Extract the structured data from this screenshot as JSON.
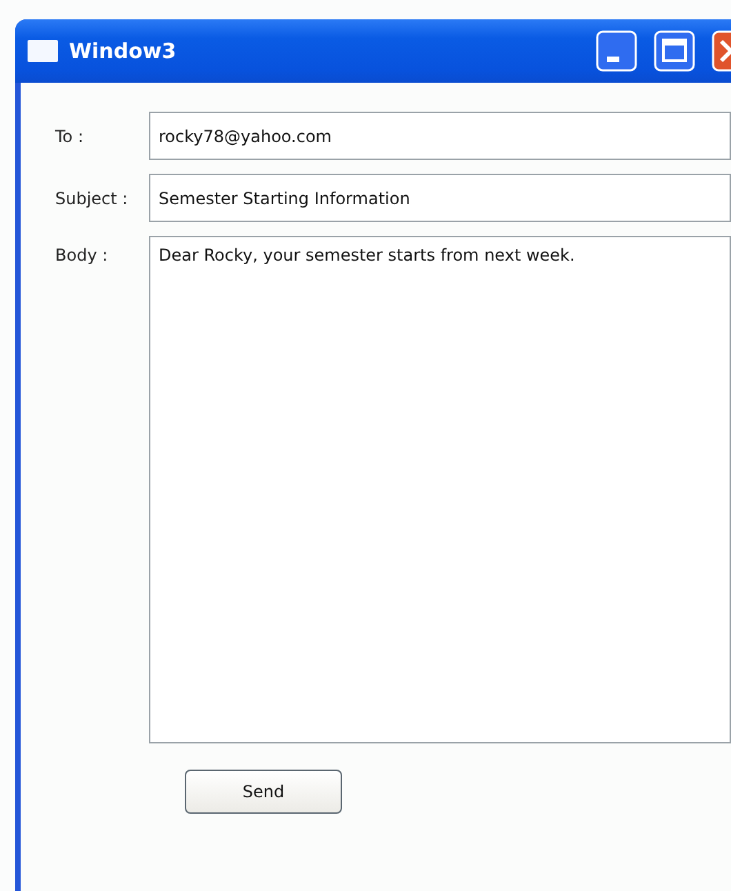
{
  "window": {
    "title": "Window3"
  },
  "fields": [
    {
      "label": "To :",
      "value": "rocky78@yahoo.com",
      "kind": "line"
    },
    {
      "label": "Subject :",
      "value": "Semester Starting Information",
      "kind": "line"
    },
    {
      "label": "Body :",
      "value": "Dear Rocky, your semester starts from next week.",
      "kind": "multiline"
    }
  ],
  "buttons": [
    "Send"
  ]
}
